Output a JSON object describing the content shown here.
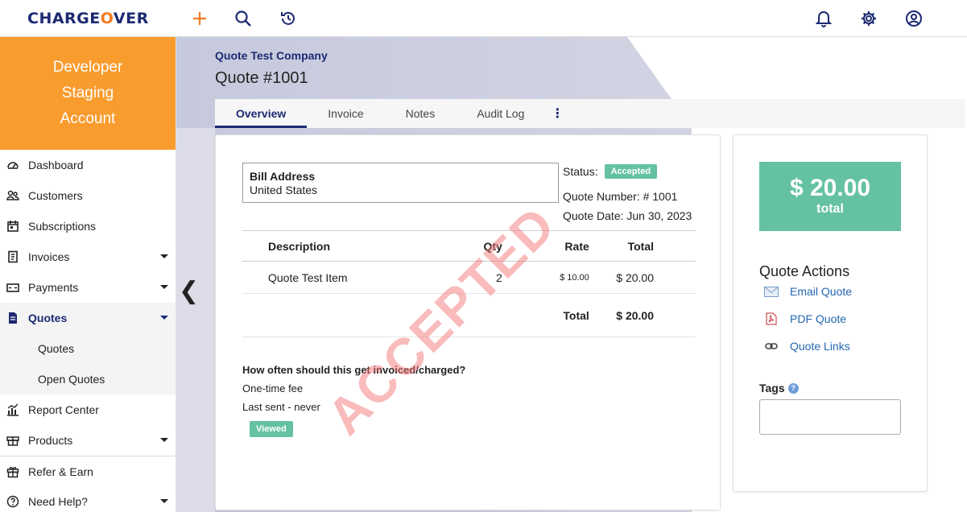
{
  "app": {
    "logo_text": "CHARGEOVER",
    "logo_left": "CHARGE",
    "logo_o": "O",
    "logo_right": "VER"
  },
  "topbar_icons": [
    "plus-icon",
    "search-icon",
    "history-icon",
    "bell-icon",
    "gear-icon",
    "user-icon"
  ],
  "sidebar": {
    "account_lines": [
      "Developer",
      "Staging",
      "Account"
    ],
    "items": [
      {
        "label": "Dashboard",
        "icon": "dashboard-icon"
      },
      {
        "label": "Customers",
        "icon": "users-icon"
      },
      {
        "label": "Subscriptions",
        "icon": "calendar-icon"
      },
      {
        "label": "Invoices",
        "icon": "invoice-icon"
      },
      {
        "label": "Payments",
        "icon": "payment-icon"
      },
      {
        "label": "Quotes",
        "icon": "quote-icon"
      },
      {
        "label": "Report Center",
        "icon": "chart-icon"
      },
      {
        "label": "Products",
        "icon": "box-icon"
      },
      {
        "label": "Refer & Earn",
        "icon": "gift-icon"
      },
      {
        "label": "Need Help?",
        "icon": "help-icon"
      }
    ],
    "quotes_sub": [
      "Quotes",
      "Open Quotes"
    ]
  },
  "header": {
    "company": "Quote Test Company",
    "title": "Quote #1001"
  },
  "tabs": [
    "Overview",
    "Invoice",
    "Notes",
    "Audit Log"
  ],
  "quote": {
    "bill_title": "Bill Address",
    "bill_line": "United States",
    "status_label": "Status:",
    "status_value": "Accepted",
    "number_line": "Quote Number: # 1001",
    "date_line": "Quote Date: Jun 30, 2023",
    "columns": {
      "description": "Description",
      "qty": "Qty",
      "rate": "Rate",
      "total": "Total"
    },
    "rows": [
      {
        "description": "Quote Test Item",
        "qty": "2",
        "rate": "$ 10.00",
        "total": "$ 20.00"
      }
    ],
    "total_label": "Total",
    "total_value": "$ 20.00",
    "freq_question": "How often should this get invoiced/charged?",
    "freq_answer": "One-time fee",
    "last_sent": "Last sent - never",
    "viewed_badge": "Viewed",
    "stamp_text": "ACCEPTED"
  },
  "side": {
    "total_amount": "$ 20.00",
    "total_label": "total",
    "actions_title": "Quote Actions",
    "actions": [
      {
        "label": "Email Quote",
        "icon": "email-icon"
      },
      {
        "label": "PDF Quote",
        "icon": "pdf-icon"
      },
      {
        "label": "Quote Links",
        "icon": "link-icon"
      }
    ],
    "tags_label": "Tags",
    "help_glyph": "?"
  },
  "colors": {
    "brand_navy": "#1b2a72",
    "brand_orange": "#f47a20",
    "account_orange": "#f99c2e",
    "accepted_green": "#65c2a0",
    "link_blue": "#2466b0",
    "stamp_red": "#f37878"
  },
  "collapse_glyph": "❮",
  "more_glyph": "⋮"
}
